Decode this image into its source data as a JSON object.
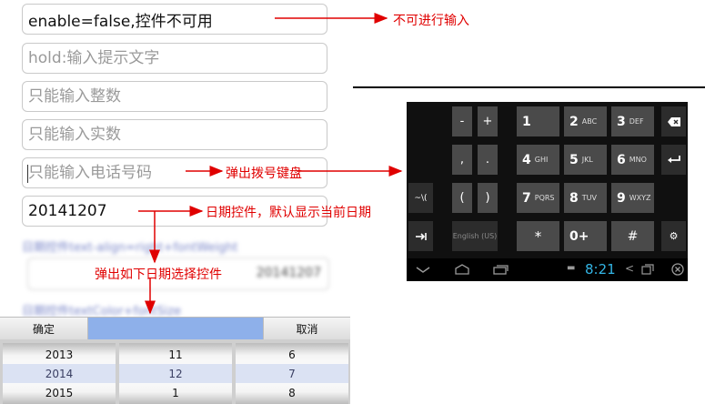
{
  "fields": {
    "disabled": "enable=false,控件不可用",
    "hint_placeholder": "hold:输入提示文字",
    "integer_placeholder": "只能输入整数",
    "decimal_placeholder": "只能输入实数",
    "phone_placeholder": "只能输入电话号码",
    "date_value": "20141207"
  },
  "annotations": {
    "disabled_note": "不可进行输入",
    "phone_note": "弹出拨号键盘",
    "date_note": "日期控件，默认显示当前日期",
    "picker_note": "弹出如下日期选择控件"
  },
  "blurred": {
    "label1": "日期控件text-align=right+fontWeight",
    "date_value": "20141207",
    "label2": "日期控件textColor+fontSize"
  },
  "keyboard": {
    "row1": {
      "minus": "-",
      "plus": "+",
      "k1": "1",
      "k2": "2",
      "k2_sub": "ABC",
      "k3": "3",
      "k3_sub": "DEF"
    },
    "row2": {
      "comma": ",",
      "period": ".",
      "k4": "4",
      "k4_sub": "GHI",
      "k5": "5",
      "k5_sub": "JKL",
      "k6": "6",
      "k6_sub": "MNO"
    },
    "row3": {
      "paren_key": "~\\(",
      "open_paren": "(",
      "close_paren": ")",
      "k7": "7",
      "k7_sub": "PQRS",
      "k8": "8",
      "k8_sub": "TUV",
      "k9": "9",
      "k9_sub": "WXYZ"
    },
    "row4": {
      "lang": "English (US)",
      "star": "*",
      "zero": "0+",
      "hash": "#",
      "settings": "⚙"
    },
    "status": {
      "time": "8:21"
    }
  },
  "picker": {
    "confirm": "确定",
    "cancel": "取消",
    "years": [
      "2013",
      "2014",
      "2015"
    ],
    "months": [
      "11",
      "12",
      "1"
    ],
    "days": [
      "6",
      "7",
      "8"
    ]
  },
  "colors": {
    "annotation": "#e00000",
    "picker_highlight": "#8eb0ea",
    "keyboard_bg": "#101010"
  }
}
